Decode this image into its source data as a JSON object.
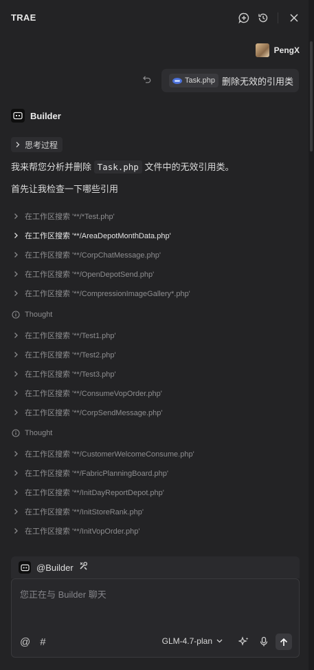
{
  "header": {
    "title": "TRAE"
  },
  "user": {
    "name": "PengX"
  },
  "user_message": {
    "file_chip": "Task.php",
    "text": "删除无效的引用类"
  },
  "builder": {
    "name": "Builder",
    "thinking_label": "思考过程"
  },
  "response": {
    "p1_before": "我来帮您分析并删除 ",
    "p1_code": "Task.php",
    "p1_after": " 文件中的无效引用类。",
    "p2": "首先让我检查一下哪些引用"
  },
  "steps": [
    {
      "type": "search",
      "label": "在工作区搜索 '**/*Test.php'"
    },
    {
      "type": "search",
      "label": "在工作区搜索 '**/AreaDepotMonthData.php'",
      "active": true
    },
    {
      "type": "search",
      "label": "在工作区搜索 '**/CorpChatMessage.php'"
    },
    {
      "type": "search",
      "label": "在工作区搜索 '**/OpenDepotSend.php'"
    },
    {
      "type": "search",
      "label": "在工作区搜索 '**/CompressionImageGallery*.php'"
    },
    {
      "type": "thought",
      "label": "Thought"
    },
    {
      "type": "search",
      "label": "在工作区搜索 '**/Test1.php'"
    },
    {
      "type": "search",
      "label": "在工作区搜索 '**/Test2.php'"
    },
    {
      "type": "search",
      "label": "在工作区搜索 '**/Test3.php'"
    },
    {
      "type": "search",
      "label": "在工作区搜索 '**/ConsumeVopOrder.php'"
    },
    {
      "type": "search",
      "label": "在工作区搜索 '**/CorpSendMessage.php'"
    },
    {
      "type": "thought",
      "label": "Thought"
    },
    {
      "type": "search",
      "label": "在工作区搜索 '**/CustomerWelcomeConsume.php'"
    },
    {
      "type": "search",
      "label": "在工作区搜索 '**/FabricPlanningBoard.php'"
    },
    {
      "type": "search",
      "label": "在工作区搜索 '**/InitDayReportDepot.php'"
    },
    {
      "type": "search",
      "label": "在工作区搜索 '**/InitStoreRank.php'"
    },
    {
      "type": "search",
      "label": "在工作区搜索 '**/InitVopOrder.php'"
    }
  ],
  "composer": {
    "context_label": "@Builder",
    "placeholder": "您正在与 Builder 聊天",
    "mention_symbol": "@",
    "hash_symbol": "#",
    "model": "GLM-4.7-plan"
  }
}
